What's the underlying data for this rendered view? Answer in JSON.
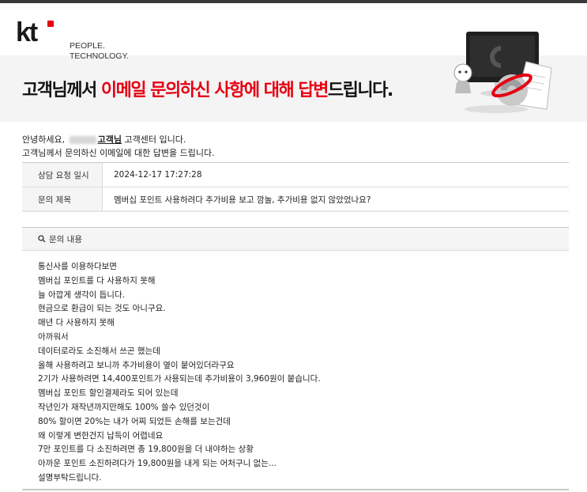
{
  "header": {
    "logo_text": "kt",
    "slogan_line1": "PEOPLE.",
    "slogan_line2": "TECHNOLOGY.",
    "headline_pre": "고객님께서 ",
    "headline_red": "이메일 문의하신 사항에 대해 답변",
    "headline_post": "드립니다."
  },
  "greeting": {
    "hello": "안녕하세요,",
    "customer": "고객님",
    "center": " 고객센터 입니다.",
    "line2": "고객님께서 문의하신 이메일에 대한 답변을 드립니다."
  },
  "info": {
    "rows": [
      {
        "label": "상담 요청 일시",
        "value": "2024-12-17 17:27:28"
      },
      {
        "label": "문의 제목",
        "value": "멤버십 포인트 사용하려다 추가비용 보고 깜놀, 추가비용 없지 않았었나요?"
      }
    ]
  },
  "inquiry": {
    "heading": "문의 내용",
    "lines": [
      "통신사를 이용하다보면",
      "멤버십 포인트를 다 사용하지 못해",
      "늘 아깝게 생각이 듭니다.",
      "현금으로 환급이 되는 것도 아니구요.",
      "매년 다 사용하지 못해",
      "아까워서",
      "데이터로라도 소진해서 쓰곤 했는데",
      "올해 사용하려고 보니까 추가비용이 옆이 붙어있더라구요",
      "2기가 사용하려면 14,400포인트가 사용되는데 추가비용이 3,960원이 붙습니다.",
      "멤버십 포인트 할인결제라도 되어 있는데",
      "작년인가 재작년까지만해도 100% 쓸수 있던것이",
      "80% 할이면 20%는 내가 어찌 되었든 손해를 보는건데",
      "왜 이렇게 변한건지 납득이 어렵네요",
      "7만 포인트를 다 소진하려면 총 19,800원을 더 내야하는 상황",
      "아까운 포인트 소진하려다가 19,800원을 내게 되는 어처구니 없는...",
      "설명부탁드립니다."
    ]
  }
}
